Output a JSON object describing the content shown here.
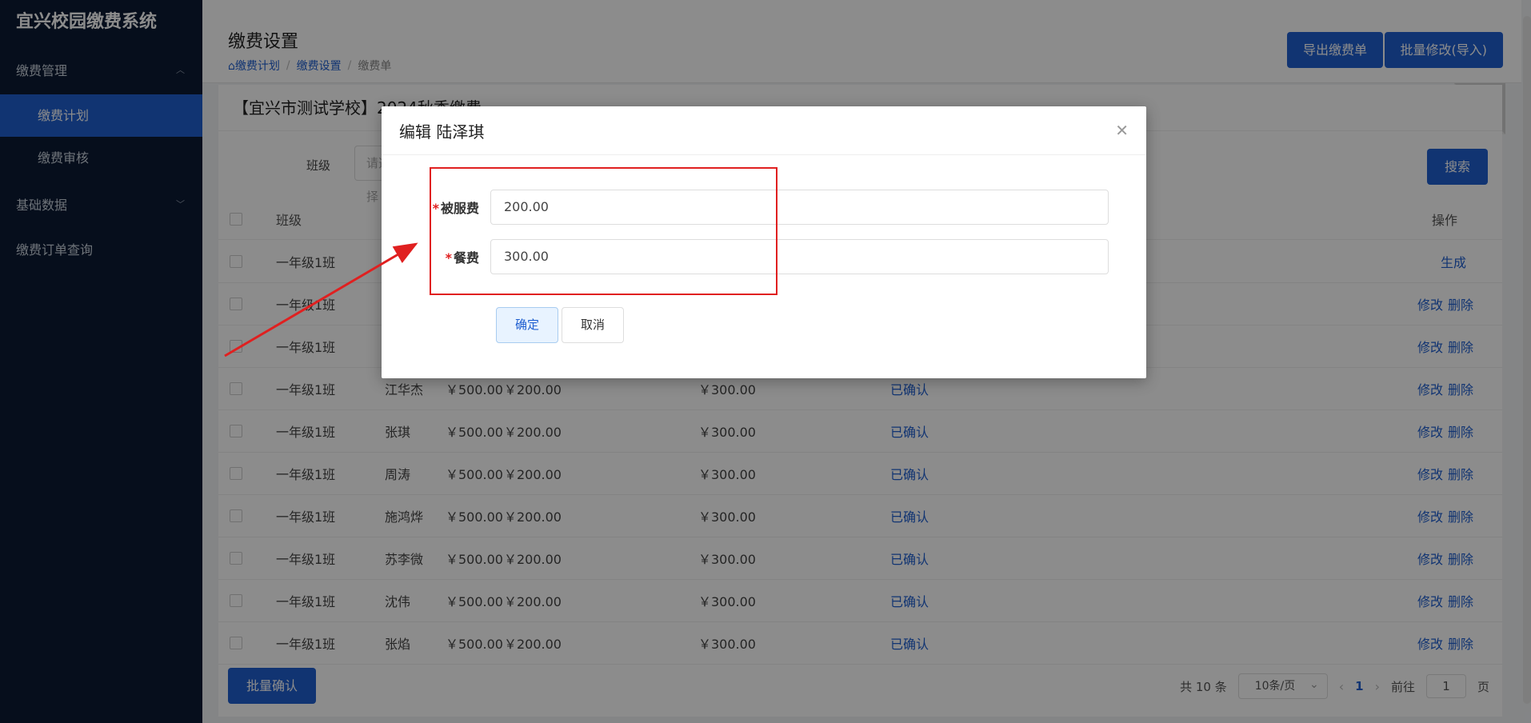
{
  "app": {
    "title": "宜兴校园缴费系统"
  },
  "sidebar": {
    "groups": [
      {
        "label": "缴费管理",
        "items": [
          {
            "label": "缴费计划"
          },
          {
            "label": "缴费审核"
          }
        ]
      },
      {
        "label": "基础数据"
      },
      {
        "label": "缴费订单查询"
      }
    ]
  },
  "header": {
    "title": "缴费设置",
    "breadcrumb": [
      "缴费计划",
      "缴费设置",
      "缴费单"
    ],
    "export_label": "导出缴费单",
    "batch_edit_label": "批量修改(导入)"
  },
  "card": {
    "title": "【宜兴市测试学校】2024秋季缴费",
    "filter_label": "班级",
    "filter_placeholder": "请选择",
    "search_label": "搜索"
  },
  "table": {
    "headers": {
      "class": "班级",
      "ops": "操作"
    },
    "rows": [
      {
        "class": "一年级1班",
        "name": "",
        "total": "",
        "f1": "",
        "f2": "",
        "status": "",
        "ops": [
          "生成"
        ]
      },
      {
        "class": "一年级1班",
        "name": "",
        "total": "",
        "f1": "",
        "f2": "",
        "status": "",
        "ops": [
          "修改",
          "删除"
        ]
      },
      {
        "class": "一年级1班",
        "name": "",
        "total": "",
        "f1": "",
        "f2": "",
        "status": "",
        "ops": [
          "修改",
          "删除"
        ]
      },
      {
        "class": "一年级1班",
        "name": "江华杰",
        "total": "￥500.00",
        "f1": "￥200.00",
        "f2": "￥300.00",
        "status": "已确认",
        "ops": [
          "修改",
          "删除"
        ]
      },
      {
        "class": "一年级1班",
        "name": "张琪",
        "total": "￥500.00",
        "f1": "￥200.00",
        "f2": "￥300.00",
        "status": "已确认",
        "ops": [
          "修改",
          "删除"
        ]
      },
      {
        "class": "一年级1班",
        "name": "周涛",
        "total": "￥500.00",
        "f1": "￥200.00",
        "f2": "￥300.00",
        "status": "已确认",
        "ops": [
          "修改",
          "删除"
        ]
      },
      {
        "class": "一年级1班",
        "name": "施鸿烨",
        "total": "￥500.00",
        "f1": "￥200.00",
        "f2": "￥300.00",
        "status": "已确认",
        "ops": [
          "修改",
          "删除"
        ]
      },
      {
        "class": "一年级1班",
        "name": "苏李微",
        "total": "￥500.00",
        "f1": "￥200.00",
        "f2": "￥300.00",
        "status": "已确认",
        "ops": [
          "修改",
          "删除"
        ]
      },
      {
        "class": "一年级1班",
        "name": "沈伟",
        "total": "￥500.00",
        "f1": "￥200.00",
        "f2": "￥300.00",
        "status": "已确认",
        "ops": [
          "修改",
          "删除"
        ]
      },
      {
        "class": "一年级1班",
        "name": "张焰",
        "total": "￥500.00",
        "f1": "￥200.00",
        "f2": "￥300.00",
        "status": "已确认",
        "ops": [
          "修改",
          "删除"
        ]
      }
    ]
  },
  "footer": {
    "bulk_confirm_label": "批量确认",
    "total_text": "共 10 条",
    "page_size": "10条/页",
    "current_page": "1",
    "goto_label": "前往",
    "goto_value": "1",
    "page_unit": "页"
  },
  "modal": {
    "title": "编辑 陆泽琪",
    "fields": [
      {
        "required": "*",
        "label": "被服费",
        "value": "200.00"
      },
      {
        "required": "*",
        "label": "餐费",
        "value": "300.00"
      }
    ],
    "ok_label": "确定",
    "cancel_label": "取消"
  },
  "colors": {
    "accent": "#1f5fd0",
    "sidebar": "#0b1a33",
    "annotation": "#e02020"
  }
}
